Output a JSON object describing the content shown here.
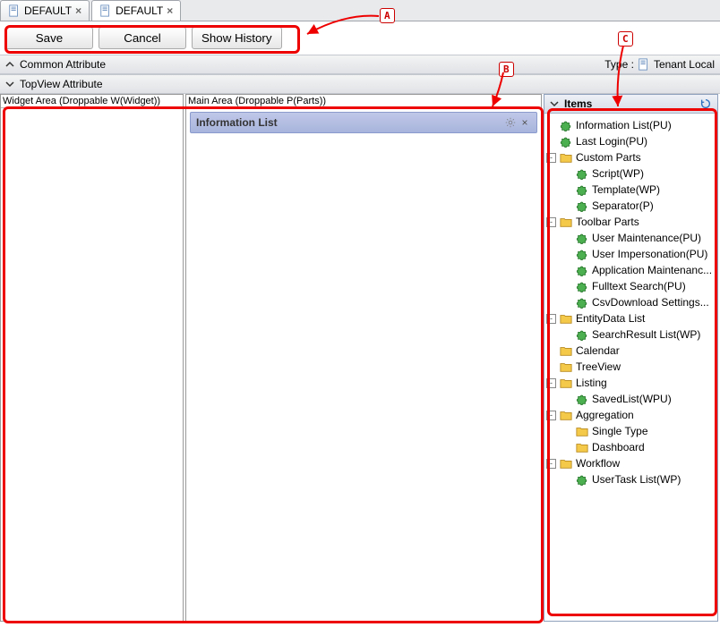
{
  "tabs": [
    {
      "label": "DEFAULT",
      "active": false
    },
    {
      "label": "DEFAULT",
      "active": true
    }
  ],
  "toolbar": {
    "save_label": "Save",
    "cancel_label": "Cancel",
    "show_history_label": "Show History"
  },
  "sections": {
    "common_attr": "Common Attribute",
    "type_label": "Type :",
    "type_value": "Tenant Local",
    "topview_attr": "TopView Attribute"
  },
  "areas": {
    "widget_header": "Widget Area (Droppable W(Widget))",
    "main_header": "Main Area (Droppable P(Parts))",
    "info_list_title": "Information List"
  },
  "items_panel": {
    "title": "Items"
  },
  "tree": [
    {
      "depth": 0,
      "exp": null,
      "icon": "puzzle",
      "label": "Information List(PU)"
    },
    {
      "depth": 0,
      "exp": null,
      "icon": "puzzle",
      "label": "Last Login(PU)"
    },
    {
      "depth": 0,
      "exp": "-",
      "icon": "folder",
      "label": "Custom Parts"
    },
    {
      "depth": 1,
      "exp": null,
      "icon": "puzzle",
      "label": "Script(WP)"
    },
    {
      "depth": 1,
      "exp": null,
      "icon": "puzzle",
      "label": "Template(WP)"
    },
    {
      "depth": 1,
      "exp": null,
      "icon": "puzzle",
      "label": "Separator(P)"
    },
    {
      "depth": 0,
      "exp": "-",
      "icon": "folder",
      "label": "Toolbar Parts"
    },
    {
      "depth": 1,
      "exp": null,
      "icon": "puzzle",
      "label": "User Maintenance(PU)"
    },
    {
      "depth": 1,
      "exp": null,
      "icon": "puzzle",
      "label": "User Impersonation(PU)"
    },
    {
      "depth": 1,
      "exp": null,
      "icon": "puzzle",
      "label": "Application Maintenanc..."
    },
    {
      "depth": 1,
      "exp": null,
      "icon": "puzzle",
      "label": "Fulltext Search(PU)"
    },
    {
      "depth": 1,
      "exp": null,
      "icon": "puzzle",
      "label": "CsvDownload Settings..."
    },
    {
      "depth": 0,
      "exp": "-",
      "icon": "folder",
      "label": "EntityData List"
    },
    {
      "depth": 1,
      "exp": null,
      "icon": "puzzle",
      "label": "SearchResult List(WP)"
    },
    {
      "depth": 0,
      "exp": null,
      "icon": "folder",
      "label": "Calendar"
    },
    {
      "depth": 0,
      "exp": null,
      "icon": "folder",
      "label": "TreeView"
    },
    {
      "depth": 0,
      "exp": "-",
      "icon": "folder",
      "label": "Listing"
    },
    {
      "depth": 1,
      "exp": null,
      "icon": "puzzle",
      "label": "SavedList(WPU)"
    },
    {
      "depth": 0,
      "exp": "-",
      "icon": "folder",
      "label": "Aggregation"
    },
    {
      "depth": 1,
      "exp": null,
      "icon": "folder",
      "label": "Single Type"
    },
    {
      "depth": 1,
      "exp": null,
      "icon": "folder",
      "label": "Dashboard"
    },
    {
      "depth": 0,
      "exp": "-",
      "icon": "folder",
      "label": "Workflow"
    },
    {
      "depth": 1,
      "exp": null,
      "icon": "puzzle",
      "label": "UserTask List(WP)"
    }
  ],
  "annotations": {
    "a": "A",
    "b": "B",
    "c": "C"
  }
}
